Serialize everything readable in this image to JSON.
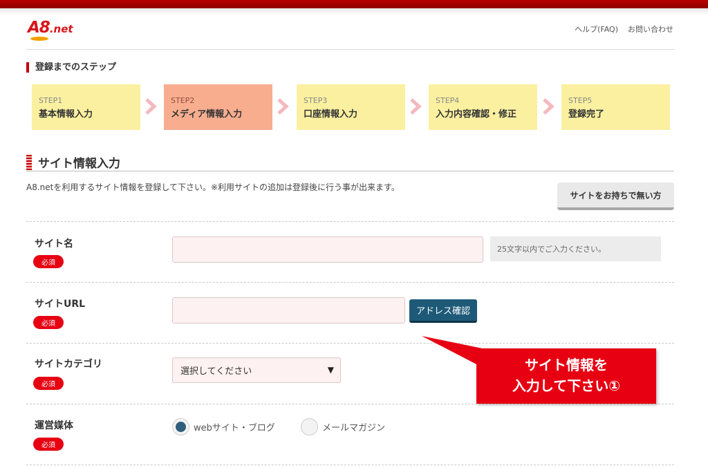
{
  "header": {
    "logo_main": "A8",
    "logo_suffix": ".net",
    "links": [
      "ヘルプ(FAQ)",
      "お問い合わせ"
    ]
  },
  "steps": {
    "title": "登録までのステップ",
    "items": [
      {
        "num": "STEP1",
        "label": "基本情報入力",
        "active": false
      },
      {
        "num": "STEP2",
        "label": "メディア情報入力",
        "active": true
      },
      {
        "num": "STEP3",
        "label": "口座情報入力",
        "active": false
      },
      {
        "num": "STEP4",
        "label": "入力内容確認・修正",
        "active": false
      },
      {
        "num": "STEP5",
        "label": "登録完了",
        "active": false
      }
    ]
  },
  "section": {
    "title": "サイト情報入力",
    "description": "A8.netを利用するサイト情報を登録して下さい。※利用サイトの追加は登録後に行う事が出来ます。",
    "no_site_button": "サイトをお持ちで無い方"
  },
  "form": {
    "required_label": "必須",
    "site_name": {
      "label": "サイト名",
      "value": "",
      "hint": "25文字以内でご入力ください。"
    },
    "site_url": {
      "label": "サイトURL",
      "value": "",
      "check_button": "アドレス確認"
    },
    "site_category": {
      "label": "サイトカテゴリ",
      "selected": "選択してください"
    },
    "media": {
      "label": "運営媒体",
      "options": [
        {
          "label": "webサイト・ブログ",
          "checked": true
        },
        {
          "label": "メールマガジン",
          "checked": false
        }
      ]
    }
  },
  "callout": {
    "line1": "サイト情報を",
    "line2": "入力して下さい①"
  },
  "colors": {
    "brand_red": "#e60012",
    "step_yellow": "#faf0a0",
    "step_active": "#f8ad8f",
    "button_blue": "#1e5a78"
  }
}
